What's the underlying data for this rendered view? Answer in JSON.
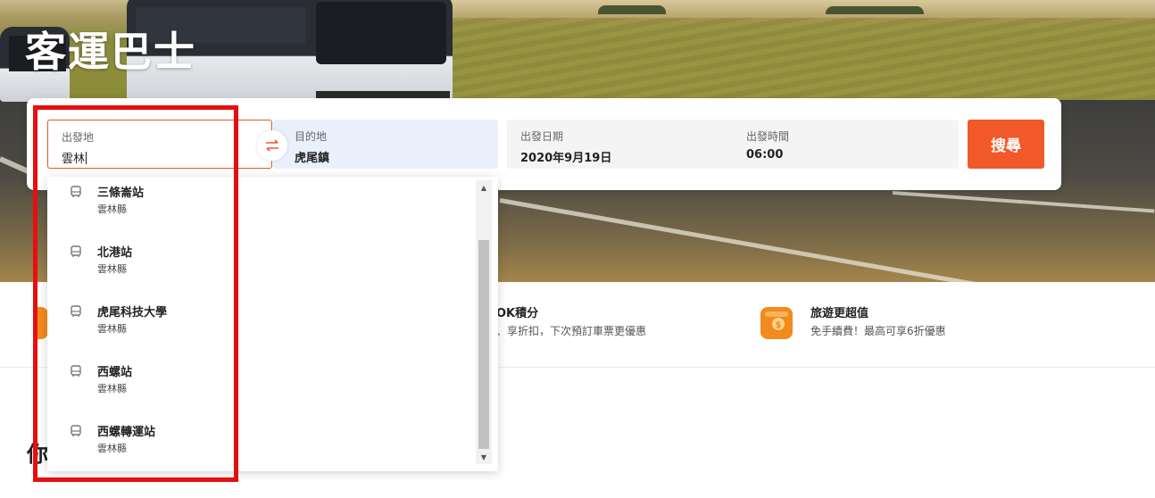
{
  "hero": {
    "title": "客運巴士"
  },
  "search": {
    "origin_label": "出發地",
    "origin_value": "雲林",
    "destination_label": "目的地",
    "destination_value": "虎尾鎮",
    "date_label": "出發日期",
    "date_value": "2020年9月19日",
    "time_label": "出發時間",
    "time_value": "06:00",
    "search_button": "搜尋"
  },
  "suggestions": [
    {
      "name": "三條崙站",
      "region": "雲林縣",
      "icon": "bus-icon"
    },
    {
      "name": "北港站",
      "region": "雲林縣",
      "icon": "bus-icon"
    },
    {
      "name": "虎尾科技大學",
      "region": "雲林縣",
      "icon": "bus-icon"
    },
    {
      "name": "西螺站",
      "region": "雲林縣",
      "icon": "bus-icon"
    },
    {
      "name": "西螺轉運站",
      "region": "雲林縣",
      "icon": "bus-icon"
    }
  ],
  "features": [
    {
      "title": "OK積分",
      "description": "、享折扣，下次預訂車票更優惠",
      "icon": "points-icon"
    },
    {
      "title": "旅遊更超值",
      "description": "免手續費！最高可享6折優惠",
      "icon": "money-icon"
    }
  ],
  "section": {
    "heading_partial": "你"
  },
  "colors": {
    "accent": "#f2592a",
    "highlight": "#e60f0f",
    "destination_bg": "#e9f0fb"
  }
}
